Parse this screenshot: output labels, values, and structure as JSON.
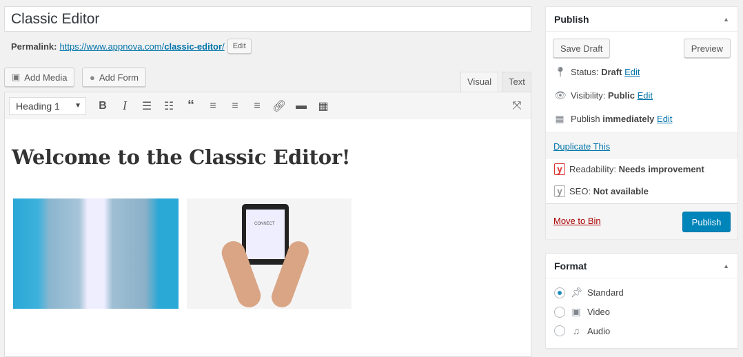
{
  "editor": {
    "title": "Classic Editor",
    "permalink_label": "Permalink:",
    "permalink_base": "https://www.appnova.com/",
    "permalink_slug": "classic-editor",
    "permalink_trail": "/",
    "permalink_edit": "Edit",
    "add_media": "Add Media",
    "add_form": "Add Form",
    "tabs": [
      {
        "label": "Visual",
        "active": true
      },
      {
        "label": "Text",
        "active": false
      }
    ],
    "format_select": "Heading 1",
    "toolbar_icons": [
      "bold-icon",
      "italic-icon",
      "bullet-list-icon",
      "numbered-list-icon",
      "blockquote-icon",
      "align-left-icon",
      "align-center-icon",
      "align-right-icon",
      "link-icon",
      "read-more-icon",
      "toolbar-toggle-icon"
    ],
    "heading": "Welcome to the Classic Editor!",
    "tablet_text": "CONNECT"
  },
  "publish": {
    "title": "Publish",
    "save_draft": "Save Draft",
    "preview": "Preview",
    "status_label": "Status:",
    "status_value": "Draft",
    "visibility_label": "Visibility:",
    "visibility_value": "Public",
    "publish_label": "Publish",
    "publish_value": "immediately",
    "edit": "Edit",
    "duplicate": "Duplicate This",
    "readability_label": "Readability:",
    "readability_value": "Needs improvement",
    "seo_label": "SEO:",
    "seo_value": "Not available",
    "move_to_bin": "Move to Bin",
    "publish_button": "Publish"
  },
  "format": {
    "title": "Format",
    "options": [
      {
        "label": "Standard",
        "selected": true
      },
      {
        "label": "Video",
        "selected": false
      },
      {
        "label": "Audio",
        "selected": false
      }
    ]
  },
  "colors": {
    "primary": "#0085ba",
    "link": "#0073aa",
    "danger": "#a00",
    "yoast_red": "#dc3232"
  }
}
